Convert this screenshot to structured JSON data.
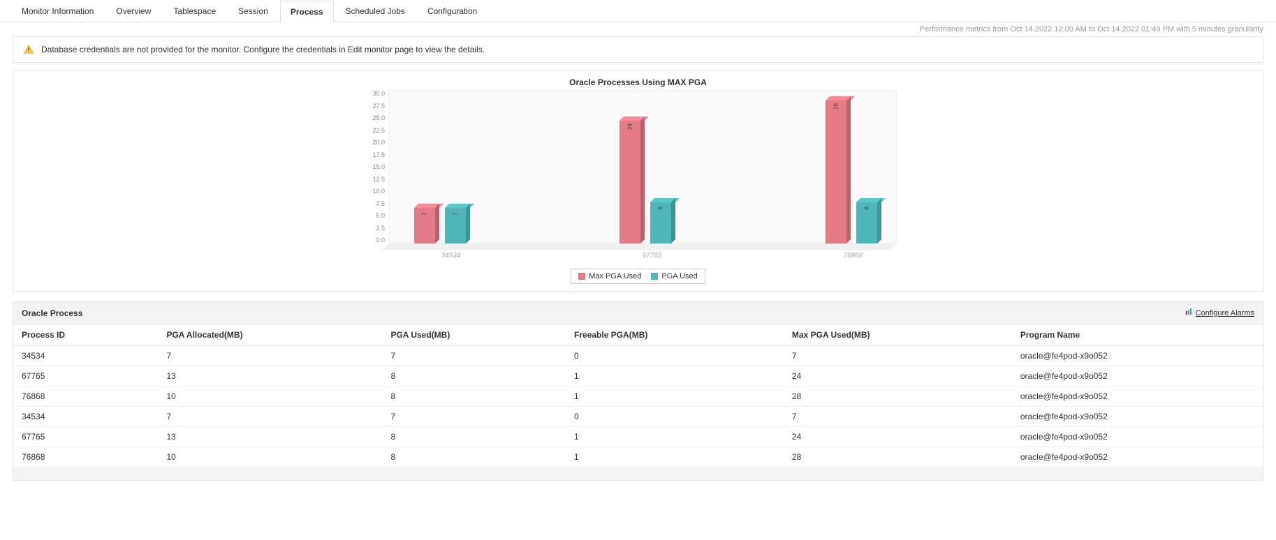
{
  "tabs": {
    "items": [
      "Monitor Information",
      "Overview",
      "Tablespace",
      "Session",
      "Process",
      "Scheduled Jobs",
      "Configuration"
    ],
    "active_index": 4
  },
  "metrics_info": "Performance metrics from Oct 14,2022 12:00 AM to Oct 14,2022 01:49 PM with 5 minutes granularity",
  "warning": {
    "text": "Database credentials are not provided for the monitor. Configure the credentials in Edit monitor page to view the details."
  },
  "chart_data": {
    "type": "bar",
    "title": "Oracle Processes Using MAX PGA",
    "categories": [
      "34534",
      "67765",
      "76868"
    ],
    "series": [
      {
        "name": "Max PGA Used",
        "values": [
          7,
          24,
          28
        ],
        "color": "#e57b87"
      },
      {
        "name": "PGA Used",
        "values": [
          7,
          8,
          8
        ],
        "color": "#4fb7bb"
      }
    ],
    "y_ticks": [
      "30.0",
      "27.5",
      "25.0",
      "22.5",
      "20.0",
      "17.5",
      "15.0",
      "12.5",
      "10.0",
      "7.5",
      "5.0",
      "2.5",
      "0.0"
    ],
    "ymax": 30,
    "xlabel": "",
    "ylabel": ""
  },
  "table": {
    "title": "Oracle Process",
    "configure_label": "Configure Alarms",
    "columns": [
      "Process ID",
      "PGA Allocated(MB)",
      "PGA Used(MB)",
      "Freeable PGA(MB)",
      "Max PGA Used(MB)",
      "Program Name"
    ],
    "rows": [
      [
        "34534",
        "7",
        "7",
        "0",
        "7",
        "oracle@fe4pod-x9o052"
      ],
      [
        "67765",
        "13",
        "8",
        "1",
        "24",
        "oracle@fe4pod-x9o052"
      ],
      [
        "76868",
        "10",
        "8",
        "1",
        "28",
        "oracle@fe4pod-x9o052"
      ],
      [
        "34534",
        "7",
        "7",
        "0",
        "7",
        "oracle@fe4pod-x9o052"
      ],
      [
        "67765",
        "13",
        "8",
        "1",
        "24",
        "oracle@fe4pod-x9o052"
      ],
      [
        "76868",
        "10",
        "8",
        "1",
        "28",
        "oracle@fe4pod-x9o052"
      ]
    ]
  }
}
